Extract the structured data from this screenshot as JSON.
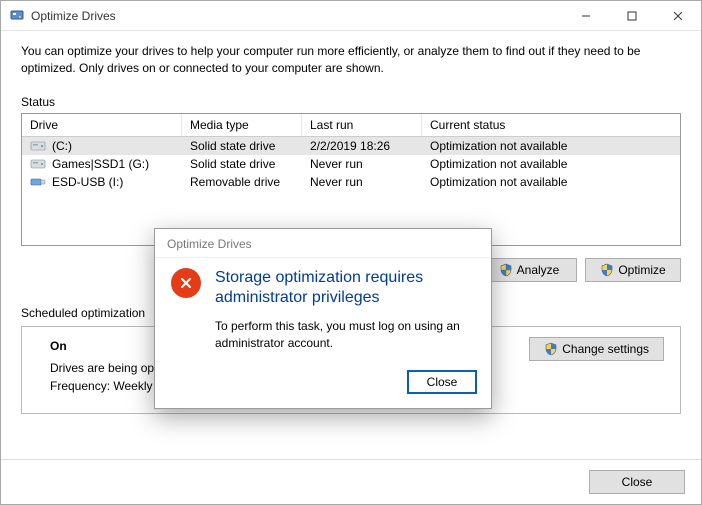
{
  "window": {
    "title": "Optimize Drives",
    "intro": "You can optimize your drives to help your computer run more efficiently, or analyze them to find out if they need to be optimized. Only drives on or connected to your computer are shown."
  },
  "status": {
    "label": "Status",
    "headers": {
      "drive": "Drive",
      "media": "Media type",
      "lastrun": "Last run",
      "status": "Current status"
    },
    "rows": [
      {
        "name": "(C:)",
        "media": "Solid state drive",
        "lastrun": "2/2/2019 18:26",
        "status": "Optimization not available",
        "selected": true,
        "icon": "hdd"
      },
      {
        "name": "Games|SSD1 (G:)",
        "media": "Solid state drive",
        "lastrun": "Never run",
        "status": "Optimization not available",
        "selected": false,
        "icon": "hdd"
      },
      {
        "name": "ESD-USB (I:)",
        "media": "Removable drive",
        "lastrun": "Never run",
        "status": "Optimization not available",
        "selected": false,
        "icon": "usb"
      }
    ]
  },
  "buttons": {
    "analyze": "Analyze",
    "optimize": "Optimize",
    "change_settings": "Change settings",
    "close": "Close"
  },
  "schedule": {
    "label": "Scheduled optimization",
    "state": "On",
    "line1": "Drives are being optimized automatically.",
    "line2": "Frequency: Weekly"
  },
  "modal": {
    "title": "Optimize Drives",
    "heading": "Storage optimization requires administrator privileges",
    "message": "To perform this task, you must log on using an administrator account.",
    "close": "Close"
  }
}
